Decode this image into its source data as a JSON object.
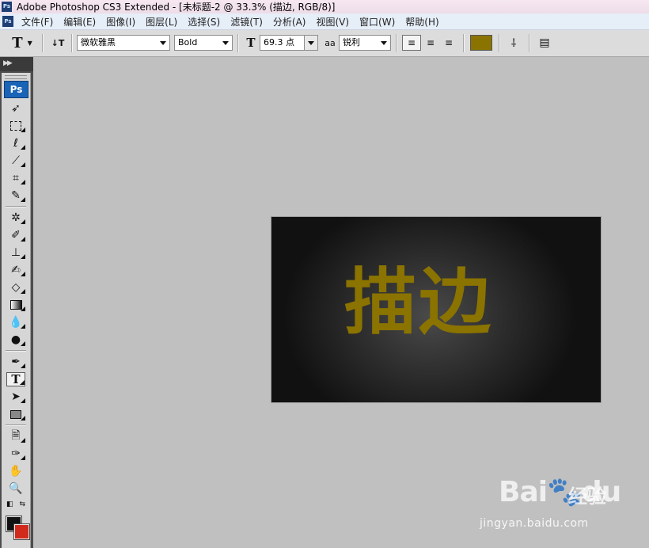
{
  "app": {
    "logo_text": "Ps",
    "title": "Adobe Photoshop CS3 Extended - [未标题-2 @ 33.3% (描边, RGB/8)]"
  },
  "menu": [
    {
      "label": "文件(F)"
    },
    {
      "label": "编辑(E)"
    },
    {
      "label": "图像(I)"
    },
    {
      "label": "图层(L)"
    },
    {
      "label": "选择(S)"
    },
    {
      "label": "滤镜(T)"
    },
    {
      "label": "分析(A)"
    },
    {
      "label": "视图(V)"
    },
    {
      "label": "窗口(W)"
    },
    {
      "label": "帮助(H)"
    }
  ],
  "options": {
    "tool_glyph": "T",
    "orientation_glyph": "↓T",
    "font_family": "微软雅黑",
    "font_style": "Bold",
    "font_size": "69.3 点",
    "antialias_label": "aa",
    "antialias": "锐利",
    "text_color": "#8b7300",
    "size_icon": "font-size-icon",
    "warp_icon": "warp-text-icon",
    "panels_icon": "character-panel-icon"
  },
  "tools": {
    "badge": "Ps",
    "foreground_color": "#111111",
    "background_color": "#d12a1c"
  },
  "canvas": {
    "text": "描边",
    "text_color": "#8b7300"
  },
  "watermark": {
    "logo": "Bai🐾du",
    "brand_cn": "经验",
    "url": "jingyan.baidu.com"
  }
}
